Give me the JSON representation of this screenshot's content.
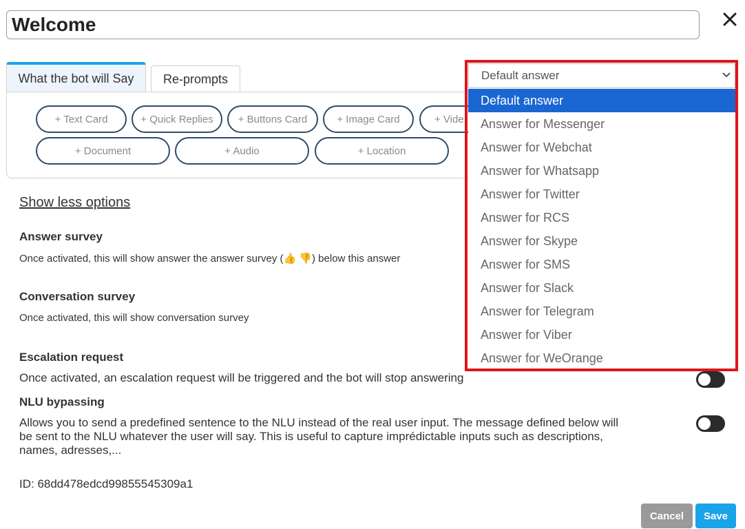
{
  "header": {
    "title_value": "Welcome"
  },
  "tabs": [
    {
      "label": "What the bot will Say"
    },
    {
      "label": "Re-prompts"
    }
  ],
  "cards": [
    "+ Text Card",
    "+ Quick Replies",
    "+ Buttons Card",
    "+ Image Card",
    "+ Vide",
    "+ Document",
    "+ Audio",
    "+ Location"
  ],
  "options_link": "Show less options",
  "sections": {
    "answer_survey": {
      "title": "Answer survey",
      "desc": "Once activated, this will show answer the answer survey (👍 👎) below this answer"
    },
    "conversation_survey": {
      "title": "Conversation survey",
      "desc": "Once activated, this will show conversation survey"
    },
    "escalation": {
      "title": "Escalation request",
      "desc": "Once activated, an escalation request will be triggered and the bot will stop answering"
    },
    "nlu": {
      "title": "NLU bypassing",
      "desc": "Allows you to send a predefined sentence to the NLU instead of the real user input. The message defined below will be sent to the NLU whatever the user will say. This is useful to capture imprédictable inputs such as descriptions, names, adresses,..."
    }
  },
  "id_line": "ID: 68dd478edcd99855545309a1",
  "buttons": {
    "cancel": "Cancel",
    "save": "Save"
  },
  "dropdown": {
    "selected": "Default answer",
    "options": [
      "Default answer",
      "Answer for Messenger",
      "Answer for Webchat",
      "Answer for Whatsapp",
      "Answer for Twitter",
      "Answer for RCS",
      "Answer for Skype",
      "Answer for SMS",
      "Answer for Slack",
      "Answer for Telegram",
      "Answer for Viber",
      "Answer for WeOrange"
    ]
  },
  "colors": {
    "accent": "#1aa3e8",
    "highlight": "#e0141b",
    "selected_option": "#1a66d2",
    "pill_border": "#2e4a6b"
  },
  "icons": {
    "close": "close-icon",
    "chevron": "chevron-down-icon"
  }
}
